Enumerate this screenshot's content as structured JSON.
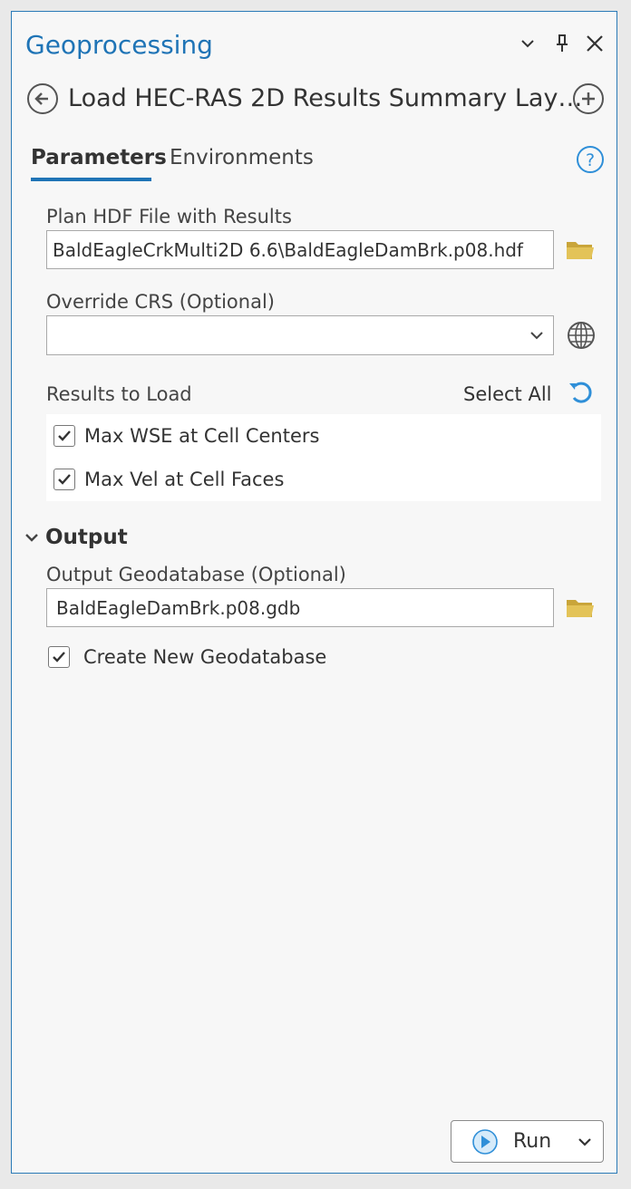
{
  "panel": {
    "title": "Geoprocessing",
    "tool_title": "Load HEC-RAS 2D Results Summary Lay…"
  },
  "tabs": [
    {
      "label": "Parameters",
      "active": true
    },
    {
      "label": "Environments",
      "active": false
    }
  ],
  "params": {
    "plan_hdf": {
      "label": "Plan HDF File with Results",
      "value": "BaldEagleCrkMulti2D 6.6\\BaldEagleDamBrk.p08.hdf"
    },
    "override_crs": {
      "label": "Override CRS (Optional)",
      "value": ""
    },
    "results": {
      "label": "Results to Load",
      "select_all": "Select All",
      "items": [
        {
          "label": "Max WSE at Cell Centers",
          "checked": true
        },
        {
          "label": "Max Vel at Cell Faces",
          "checked": true
        }
      ]
    }
  },
  "output": {
    "section_label": "Output",
    "gdb_label": "Output Geodatabase (Optional)",
    "gdb_value": "BaldEagleDamBrk.p08.gdb",
    "create_new": {
      "label": "Create New Geodatabase",
      "checked": true
    }
  },
  "run": {
    "label": "Run"
  },
  "colors": {
    "accent": "#1f74b6",
    "folder": "#d6b33f",
    "reset": "#2f8fd8"
  },
  "icons": [
    "chevron-down-icon",
    "pin-icon",
    "close-icon",
    "back-arrow-icon",
    "add-icon",
    "help-icon",
    "folder-icon",
    "globe-icon",
    "reset-icon",
    "checkmark-icon",
    "play-icon"
  ]
}
